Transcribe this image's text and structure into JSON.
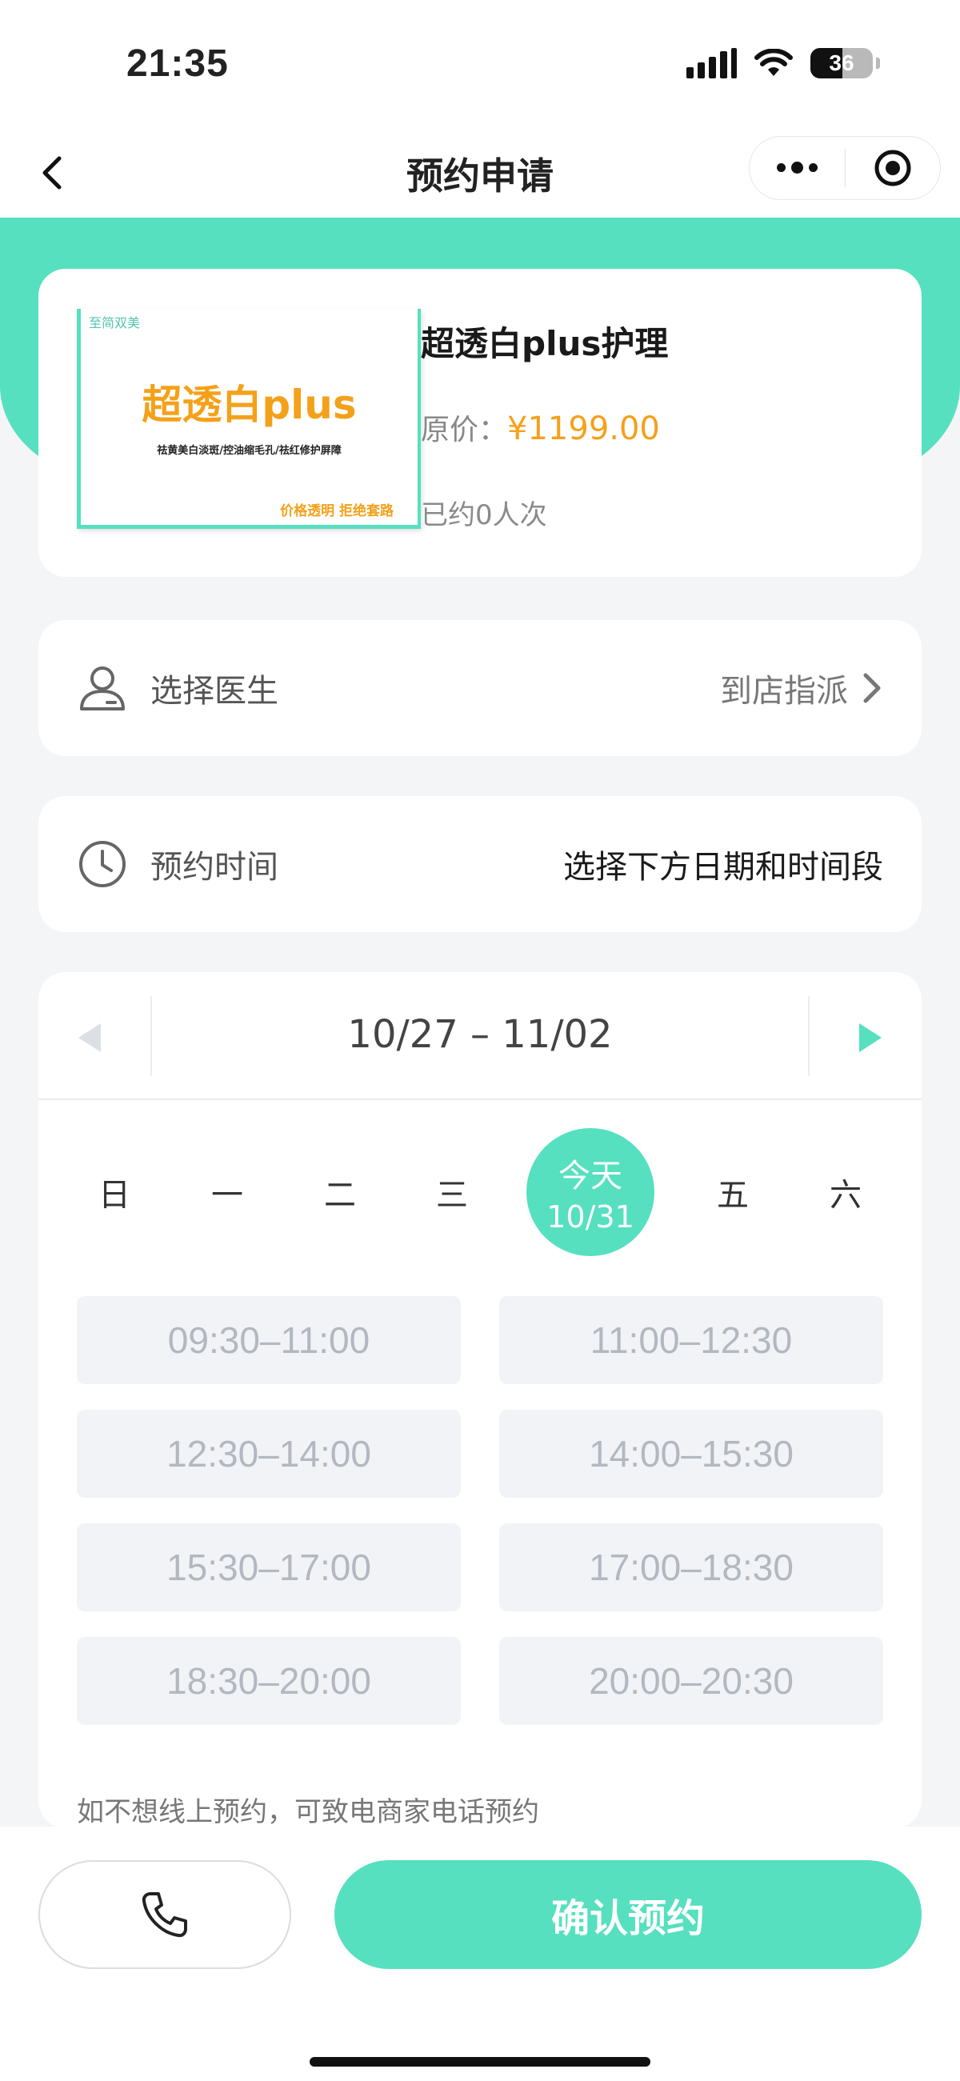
{
  "status": {
    "time": "21:35",
    "battery": "36"
  },
  "nav": {
    "title": "预约申请"
  },
  "product": {
    "logo_text": "至简双美",
    "image_title": "超透白plus",
    "image_subtitle": "祛黄美白淡斑/控油缩毛孔/祛红修护屏障",
    "image_footer": "价格透明  拒绝套路",
    "name": "超透白plus护理",
    "price_label": "原价：",
    "price": "¥1199.00",
    "booked": "已约0人次"
  },
  "doctor": {
    "label": "选择医生",
    "value": "到店指派"
  },
  "time": {
    "label": "预约时间",
    "value": "选择下方日期和时间段"
  },
  "schedule": {
    "range": "10/27 – 11/02",
    "days": [
      "日",
      "一",
      "二",
      "三",
      "五",
      "六"
    ],
    "today": {
      "label": "今天",
      "date": "10/31"
    },
    "slots": [
      "09:30–11:00",
      "11:00–12:30",
      "12:30–14:00",
      "14:00–15:30",
      "15:30–17:00",
      "17:00–18:30",
      "18:30–20:00",
      "20:00–20:30"
    ],
    "note": "如不想线上预约，可致电商家电话预约"
  },
  "actions": {
    "confirm": "确认预约"
  },
  "colors": {
    "accent": "#56e0bf",
    "price": "#f5a01a"
  },
  "icons": [
    "back-icon",
    "more-icon",
    "target-icon",
    "user-icon",
    "chevron-right-icon",
    "clock-icon",
    "prev-week-icon",
    "next-week-icon",
    "phone-icon"
  ]
}
